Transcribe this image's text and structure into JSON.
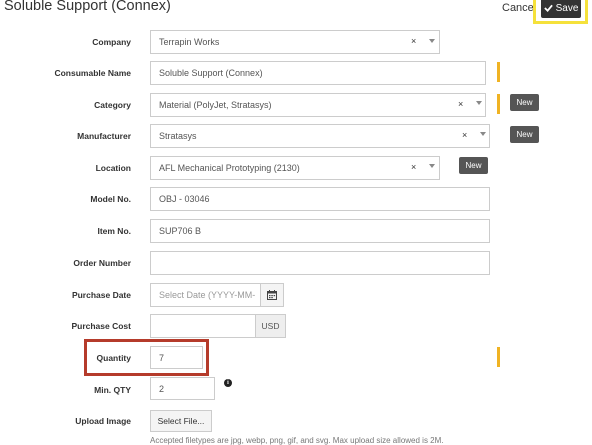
{
  "header": {
    "title": "Soluble Support (Connex)",
    "cancel_label": "Cancel",
    "save_label": "Save"
  },
  "form": {
    "company": {
      "label": "Company",
      "value": "Terrapin Works",
      "clear": "×"
    },
    "consumable_name": {
      "label": "Consumable Name",
      "value": "Soluble Support (Connex)"
    },
    "category": {
      "label": "Category",
      "value": "Material (PolyJet, Stratasys)",
      "clear": "×",
      "new_label": "New"
    },
    "manufacturer": {
      "label": "Manufacturer",
      "value": "Stratasys",
      "clear": "×",
      "new_label": "New"
    },
    "location": {
      "label": "Location",
      "value": "AFL Mechanical Prototyping (2130)",
      "clear": "×",
      "new_label": "New"
    },
    "model_no": {
      "label": "Model No.",
      "value": "OBJ - 03046"
    },
    "item_no": {
      "label": "Item No.",
      "value": "SUP706 B"
    },
    "order_number": {
      "label": "Order Number",
      "value": ""
    },
    "purchase_date": {
      "label": "Purchase Date",
      "placeholder": "Select Date (YYYY-MM-"
    },
    "purchase_cost": {
      "label": "Purchase Cost",
      "value": "",
      "currency": "USD"
    },
    "quantity": {
      "label": "Quantity",
      "value": "7"
    },
    "min_qty": {
      "label": "Min. QTY",
      "value": "2",
      "info": "i"
    },
    "upload_image": {
      "label": "Upload Image",
      "button_label": "Select File...",
      "help": "Accepted filetypes are jpg, webp, png, gif, and svg. Max upload size allowed is 2M."
    }
  },
  "colors": {
    "required_bar": "#f0b323",
    "save_highlight": "#f5e13b",
    "quantity_highlight": "#b53b2b"
  }
}
